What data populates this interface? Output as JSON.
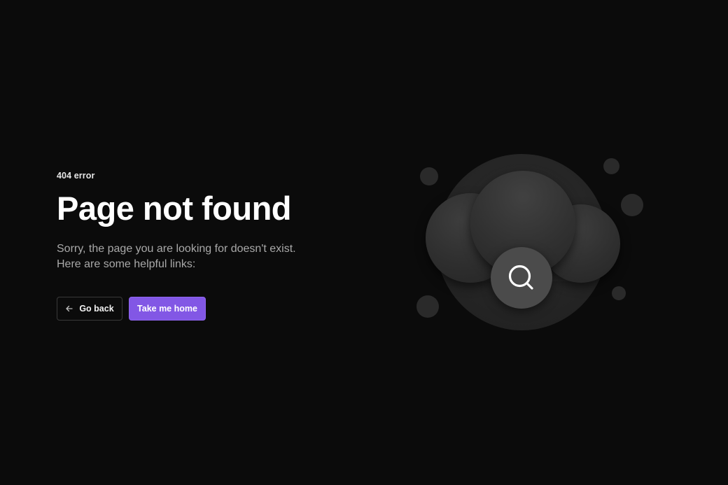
{
  "error": {
    "code_label": "404 error",
    "title": "Page not found",
    "description_line1": "Sorry, the page you are looking for doesn't exist.",
    "description_line2": "Here are some helpful links:"
  },
  "actions": {
    "back_label": "Go back",
    "back_icon": "arrow-left-icon",
    "home_label": "Take me home"
  },
  "illustration": {
    "icon": "search-icon"
  },
  "colors": {
    "background": "#0b0b0b",
    "accent": "#8257e5",
    "muted_text": "#a9a9a9"
  }
}
